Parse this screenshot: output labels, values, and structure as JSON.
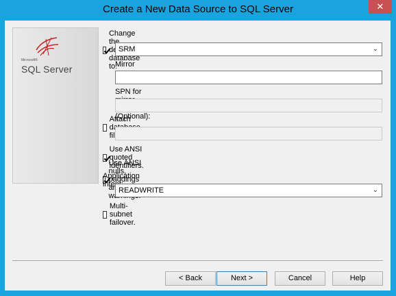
{
  "window": {
    "title": "Create a New Data Source to SQL Server",
    "close_glyph": "✕"
  },
  "banner": {
    "logo_small": "Microsoft®",
    "logo_text": "SQL Server"
  },
  "form": {
    "change_default_db": {
      "label": "Change the default database to:",
      "checked": true
    },
    "default_db_value": "SRM",
    "mirror_server_label": "Mirror server:",
    "mirror_server_value": "",
    "spn_label": "SPN for mirror server (Optional):",
    "spn_value": "",
    "attach_db": {
      "label": "Attach database filename:",
      "checked": false
    },
    "attach_db_value": "",
    "ansi_quoted": {
      "label": "Use ANSI quoted identifiers.",
      "checked": true
    },
    "ansi_nulls": {
      "label": "Use ANSI nulls, paddings and warnings.",
      "checked": true
    },
    "app_intent_label": "Application intent:",
    "app_intent_value": "READWRITE",
    "multi_subnet": {
      "label": "Multi-subnet failover.",
      "checked": false
    }
  },
  "buttons": {
    "back": "< Back",
    "next": "Next >",
    "cancel": "Cancel",
    "help": "Help"
  },
  "icons": {
    "dropdown": "chevron-down-icon",
    "logo": "sql-server-logo-icon"
  }
}
